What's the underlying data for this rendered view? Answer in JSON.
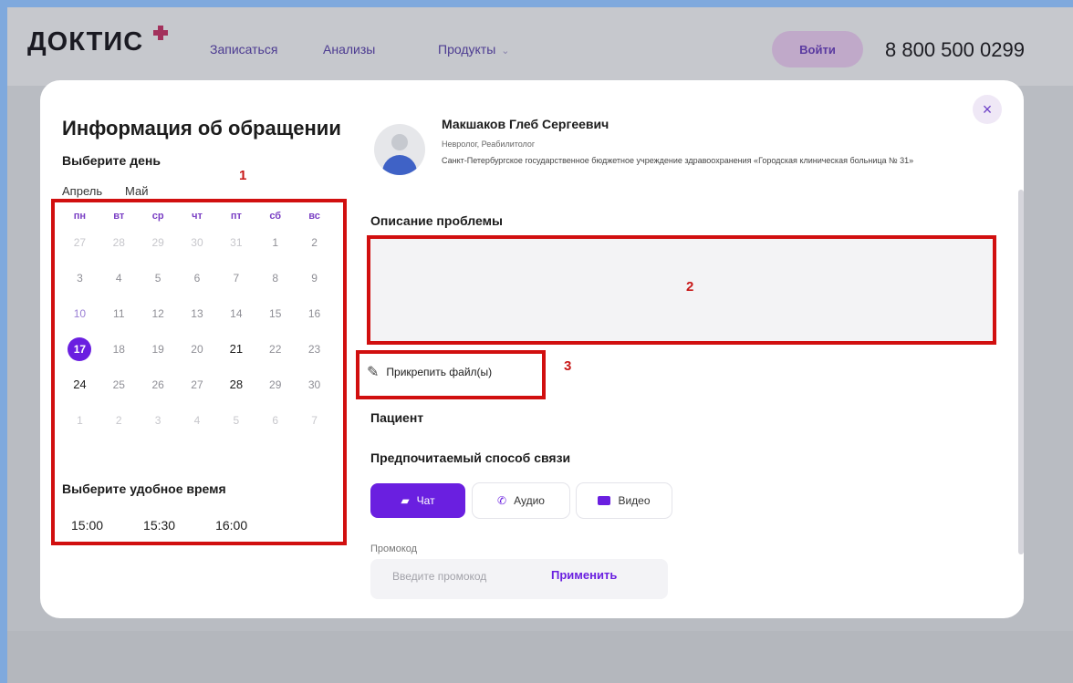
{
  "header": {
    "logo": "ДОКТИС",
    "nav": [
      "Записаться",
      "Анализы",
      "Продукты"
    ],
    "login_label": "Войти",
    "phone": "8 800 500 0299"
  },
  "modal": {
    "title": "Информация об обращении",
    "choose_day": "Выберите день",
    "months": [
      "Апрель",
      "Май"
    ],
    "weekdays": [
      "пн",
      "вт",
      "ср",
      "чт",
      "пт",
      "сб",
      "вс"
    ],
    "weeks": [
      [
        "27",
        "28",
        "29",
        "30",
        "31",
        "1",
        "2"
      ],
      [
        "3",
        "4",
        "5",
        "6",
        "7",
        "8",
        "9"
      ],
      [
        "10",
        "11",
        "12",
        "13",
        "14",
        "15",
        "16"
      ],
      [
        "17",
        "18",
        "19",
        "20",
        "21",
        "22",
        "23"
      ],
      [
        "24",
        "25",
        "26",
        "27",
        "28",
        "29",
        "30"
      ],
      [
        "1",
        "2",
        "3",
        "4",
        "5",
        "6",
        "7"
      ]
    ],
    "selected_day": "17",
    "choose_time": "Выберите удобное время",
    "times": [
      "15:00",
      "15:30",
      "16:00"
    ],
    "doctor": {
      "name": "Макшаков Глеб Сергеевич",
      "specialty": "Невролог, Реабилитолог",
      "clinic": "Санкт-Петербургское государственное бюджетное учреждение здравоохранения «Городская клиническая больница № 31»"
    },
    "problem_label": "Описание проблемы",
    "attach_label": "Прикрепить файл(ы)",
    "patient_label": "Пациент",
    "contact_label": "Предпочитаемый способ связи",
    "contact_options": [
      "Чат",
      "Аудио",
      "Видео"
    ],
    "promo_label": "Промокод",
    "promo_placeholder": "Введите промокод",
    "apply_label": "Применить",
    "close": "×"
  },
  "annotations": [
    "1",
    "2",
    "3"
  ],
  "colors": {
    "accent": "#6a1fe0",
    "highlight": "#d10f0f",
    "logo_cross": "#a3315c"
  }
}
